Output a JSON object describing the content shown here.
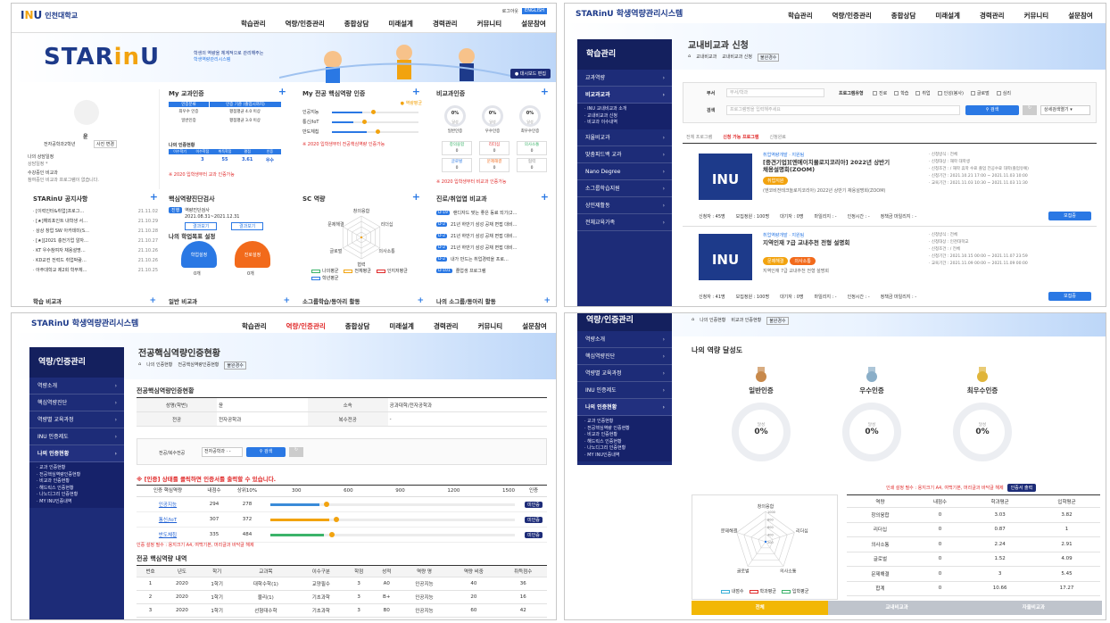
{
  "p1": {
    "logo_text": "인천대학교",
    "topbar_right": [
      "로그아웃",
      "ENGLISH"
    ],
    "nav": [
      "학습관리",
      "역량/인증관리",
      "종합상담",
      "미래설계",
      "경력관리",
      "커뮤니티",
      "설문참여"
    ],
    "banner": {
      "brand_pre": "STAR",
      "brand_mid": "in",
      "brand_post": "U",
      "sub1": "학생의 역량을 체계적으로 관리해주는",
      "sub2": "학생역량관리시스템",
      "dash_btn": "대시보드 편집"
    },
    "profile": {
      "name": "윤",
      "dept": "전자공학과2학년",
      "photo_btn": "사진 변경",
      "label1": "나의 상담일정",
      "value1": "상담일정 *",
      "label2": "수강중인 비교과",
      "value2": "참여중인 비교과 프로그램이 없습니다."
    },
    "my_cert": {
      "title": "My 교과인증",
      "h1": "인증분류",
      "h2": "인증 기준 (졸업시까지)",
      "r1a": "최우수 인증",
      "r1b": "평점평균 4.0 이상",
      "r2a": "일반인증",
      "r2b": "평점평균 3.0 이상",
      "sub": "나의 인증현황",
      "cols": [
        "이수학기",
        "이수학점",
        "취득학점",
        "평점",
        "인증"
      ],
      "vals": [
        "3",
        "55",
        "3.61",
        "우수"
      ],
      "note": "※ 2020 입학생부터 교과 인증가능"
    },
    "my_major": {
      "title": "My 전공 핵심역량 인증",
      "legend": "● 역량평균",
      "bars": [
        "인공지능",
        "통신/IoT",
        "반도체칩"
      ],
      "fills": [
        0.35,
        0.25,
        0.4
      ],
      "note": "※ 2020 입학생부터 전공핵심역량 인증가능"
    },
    "noncur": {
      "title": "비교과인증",
      "rings": [
        {
          "pct": "0%",
          "sub": "달성",
          "label": "일반인증"
        },
        {
          "pct": "0%",
          "sub": "달성",
          "label": "우수인증"
        },
        {
          "pct": "0%",
          "sub": "달성",
          "label": "최우수인증"
        }
      ],
      "boxes": [
        {
          "name": "창의융합",
          "val": "0"
        },
        {
          "name": "리더십",
          "val": "0"
        },
        {
          "name": "의사소통",
          "val": "0"
        },
        {
          "name": "글로벌",
          "val": "0"
        },
        {
          "name": "문제해결",
          "val": "0"
        },
        {
          "name": "협력",
          "val": "0"
        }
      ],
      "note": "※ 2020 입학생부터 비교과 인증가능"
    },
    "notice": {
      "title": "STARinU 공지사항",
      "items": [
        [
          "[이력인터&취업]프로그…",
          "21.11.02"
        ],
        [
          "[★]해외포인트 내학생 서…",
          "21.10.29"
        ],
        [
          "상상 창업 SW 아카데미(S…",
          "21.10.28"
        ],
        [
          "[★][2021 충전기업 알자…",
          "21.10.27"
        ],
        [
          "KT 우수참여자 채용설명…",
          "21.10.26"
        ],
        [
          "KD교컨 전력드 취업박람…",
          "21.10.26"
        ],
        [
          "아주대학교 제2회 학부체…",
          "21.10.25"
        ]
      ]
    },
    "diag": {
      "title": "핵심역량진단검사",
      "badge": "진행",
      "name": "역량진단검사",
      "period": "2021.08.31~2021.12.31",
      "btn1": "결과보기",
      "btn2": "결과보기",
      "goal_title": "나의 학업목표 설정",
      "g1": "학업설정",
      "g2": "진로설정",
      "g1v": "0개",
      "g2v": "0개"
    },
    "sc": {
      "title": "SC 역량",
      "labels": [
        "창의융합",
        "리더십",
        "의사소통",
        "협력",
        "글로벌",
        "문제해결"
      ],
      "legend": [
        "나의평균",
        "전체평균",
        "인지저평균",
        "학년평균"
      ]
    },
    "career": {
      "title": "진로/취업엽 비교과",
      "items": [
        [
          "D-19",
          "랜디자드 맞는 좋은 동료 되기(2…"
        ],
        [
          "D-2",
          "21년 하반기 삼성 공채 면접 대비…"
        ],
        [
          "D-2",
          "21년 하반기 삼성 공채 면접 대비…"
        ],
        [
          "D-2",
          "21년 하반기 삼성 공채 면접 대비…"
        ],
        [
          "D-2",
          "내가 만드는 취업경력을 프로…"
        ],
        [
          "D-101",
          "졸업생 프로그램"
        ]
      ]
    },
    "bottom": [
      "학습 비교과",
      "일반 비교과",
      "소그룹학습/동아리 활동",
      "나의 소그룹/동아리 활동"
    ]
  },
  "p2": {
    "brand": "STARinU 학생역량관리시스템",
    "nav": [
      "학습관리",
      "역량/인증관리",
      "종합상담",
      "미래설계",
      "경력관리",
      "커뮤니티",
      "설문참여"
    ],
    "side_title": "학습관리",
    "menu": [
      "교과역량",
      "비교과교과",
      "자율비교과",
      "맞춤피드백 교과",
      "Nano Degree",
      "소그룹학습지원",
      "상민제활동",
      "전체교육가족"
    ],
    "menu_active": "비교과교과",
    "sub": [
      "INU 교내비교과 소개",
      "교내비교과 신청",
      "비교과 이수내역"
    ],
    "page_title": "교내비교과 신청",
    "breadcrumb": [
      "⌂",
      "교내비교과",
      "교내비교과 신청",
      "불완경수"
    ],
    "search": {
      "dept_label": "부서",
      "dept_ph": "부서/학과",
      "type_label": "프로그램유형",
      "types": [
        "진로",
        "학습",
        "취업",
        "인성(봉사)",
        "글로벌",
        "심리"
      ],
      "kw_label": "검색",
      "kw_ph": "프로그램명을 입력해주세요",
      "btn": "검색",
      "select": "상세검색열기"
    },
    "tabs": [
      "전체 프로그램",
      "신청 가능 프로그램",
      "신청완료"
    ],
    "cards": [
      {
        "meta": "취업역량개발 · 지원팀",
        "title": "[중견기업][엔에이치몰로지코리아] 2022년 상반기 채용설명회(ZOOM)",
        "tags": [
          "취업지원"
        ],
        "desc": "(엔코비전테크놀로지코리아) 2022년 상반기 채용설명회(ZOOM)",
        "info": [
          "신청방식 : 전체",
          "신청대상 : 재학 대학생",
          "신청조건 : / 재학 휴학 수료 졸업 전공수료 대학(졸업유예)",
          "신청기간 : 2021.10.21 17:00 ~ 2021.11.03 10:00",
          "교육기간 : 2021.11.03 10:30 ~ 2021.11.03 11:30"
        ],
        "stats": [
          "신청자 : 45명",
          "모집정원 : 100명",
          "대기자 : 0명",
          "마일리지 : -",
          "인정시간 : -",
          "정책금 마일리지 : -"
        ],
        "apply": "모집중"
      },
      {
        "meta": "취업역량개발 · 지원팀",
        "title": "지역인재 7급 교내추천 전형 설명회",
        "tags": [
          "문제해결",
          "의사소통"
        ],
        "desc": "지역인재 7급 교내추천 전형 설명회",
        "info": [
          "신청방식 : 전체",
          "신청대상 : 인천대학교",
          "신청조건 : / 전체",
          "신청기간 : 2021.10.15 00:00 ~ 2021.11.07 23:59",
          "교육기간 : 2021.11.09 00:00 ~ 2021.11.09 00:00"
        ],
        "stats": [
          "신청자 : 41명",
          "모집정원 : 100명",
          "대기자 : 0명",
          "마일리지 : -",
          "인정시간 : -",
          "정책금 마일리지 : -"
        ],
        "apply": "모집중"
      }
    ]
  },
  "p3": {
    "brand": "STARinU 학생역량관리시스템",
    "nav": [
      "학습관리",
      "역량/인증관리",
      "종합상담",
      "미래설계",
      "경력관리",
      "커뮤니티",
      "설문참여"
    ],
    "side_title": "역량/인증관리",
    "menu": [
      "역량소개",
      "핵심역량진단",
      "역량별 교육과정",
      "INU 인증제도",
      "나의 인증현황"
    ],
    "menu_active": "나의 인증현황",
    "sub": [
      "교과 인증현황",
      "전공핵심역량인증현황",
      "비교과 인증현황",
      "해드릭스 인증현황",
      "나노디그리 인증현황",
      "MY INU인증내역"
    ],
    "page_title": "전공핵심역량인증현황",
    "breadcrumb": [
      "⌂",
      "나의 인증현황",
      "전공핵심역량인증현황",
      "불완경수"
    ],
    "section": "전공핵심역량인증현황",
    "info": {
      "k1": "성명(학번)",
      "v1": "윤",
      "k2": "소속",
      "v2": "공과대학/전자공학과",
      "k3": "전공",
      "v3": "전자공학과",
      "k4": "복수전공",
      "v4": "-"
    },
    "filter": {
      "label": "전공/복수전공",
      "sel": "전자공학과 · -",
      "btn": "검색"
    },
    "warn": "※ [인증] 상태를 클릭하면 인증서를 출력할 수 있습니다.",
    "tbl_head": [
      "인증 핵심역량",
      "내점수",
      "상위10%",
      "300",
      "600",
      "900",
      "1200",
      "1500",
      "인증"
    ],
    "rows": [
      {
        "name": "인공지능",
        "score": "294",
        "top": "278",
        "fill": 0.2,
        "color": "#3a8bd8",
        "btn": "미인증"
      },
      {
        "name": "통신/IoT",
        "score": "307",
        "top": "372",
        "fill": 0.24,
        "color": "#f2a30f",
        "btn": "미인증"
      },
      {
        "name": "반도체칩",
        "score": "335",
        "top": "484",
        "fill": 0.22,
        "color": "#3bb36a",
        "btn": "미인증"
      }
    ],
    "note": "인증 설정 필수 : 용지크기 A4, 여백기본, 머리글과 바닥글 해제",
    "detail_title": "전공 핵심역량 내역",
    "detail_head": [
      "번호",
      "년도",
      "학기",
      "교과목",
      "이수구분",
      "학점",
      "성적",
      "역량 명",
      "역량 비중",
      "취득점수"
    ],
    "detail_rows": [
      [
        "1",
        "2020",
        "1학기",
        "대학수학(1)",
        "교양필수",
        "3",
        "A0",
        "인공지능",
        "40",
        "36"
      ],
      [
        "2",
        "2020",
        "1학기",
        "물리(1)",
        "기초과학",
        "3",
        "B+",
        "인공지능",
        "20",
        "16"
      ],
      [
        "3",
        "2020",
        "1학기",
        "선형대수학",
        "기초과학",
        "3",
        "B0",
        "인공지능",
        "60",
        "42"
      ]
    ]
  },
  "p4": {
    "side_title": "역량/인증관리",
    "menu": [
      "역량소개",
      "핵심역량진단",
      "역량별 교육과정",
      "INU 인증제도",
      "나의 인증현황"
    ],
    "menu_active": "나의 인증현황",
    "sub": [
      "교과 인증현황",
      "전공핵심역량 인증현황",
      "비교과 인증현황",
      "해드릭스 인증현황",
      "나노디그리 인증현황",
      "MY INU인증내역"
    ],
    "breadcrumb": [
      "⌂",
      "나의 인증현황",
      "비교과 인증현황",
      "불완경수"
    ],
    "title": "나의 역량 달성도",
    "medals": [
      {
        "label": "일반인증",
        "pct": "0%",
        "sub": "달성",
        "color": "#c8894b"
      },
      {
        "label": "우수인증",
        "pct": "0%",
        "sub": "달성",
        "color": "#8aaec8"
      },
      {
        "label": "최우수인증",
        "pct": "0%",
        "sub": "달성",
        "color": "#e0b53a"
      }
    ],
    "print_note": "인쇄 설정 필수 : 용지크기 A4, 여백기본, 머리글과 바닥글 해제",
    "print_btn": "인증서 출력",
    "radar_labels": [
      "창의융합",
      "리더십",
      "의사소통",
      "글로벌",
      "문제해결"
    ],
    "radar_ticks": [
      "1000",
      "800",
      "600",
      "400",
      "200"
    ],
    "radar_legend": [
      "내점수",
      "학과평균",
      "입학평균"
    ],
    "tbl_head": [
      "역량",
      "내점수",
      "학과평균",
      "입학평균"
    ],
    "tbl_rows": [
      [
        "창의융합",
        "0",
        "3.03",
        "3.82"
      ],
      [
        "리더십",
        "0",
        "0.87",
        "1"
      ],
      [
        "의사소통",
        "0",
        "2.24",
        "2.91"
      ],
      [
        "글로벌",
        "0",
        "1.52",
        "4.09"
      ],
      [
        "문제해결",
        "0",
        "3",
        "5.45"
      ],
      [
        "합계",
        "0",
        "10.66",
        "17.27"
      ]
    ],
    "tabs": [
      "전체",
      "교내비교과",
      "자율비교과"
    ]
  }
}
